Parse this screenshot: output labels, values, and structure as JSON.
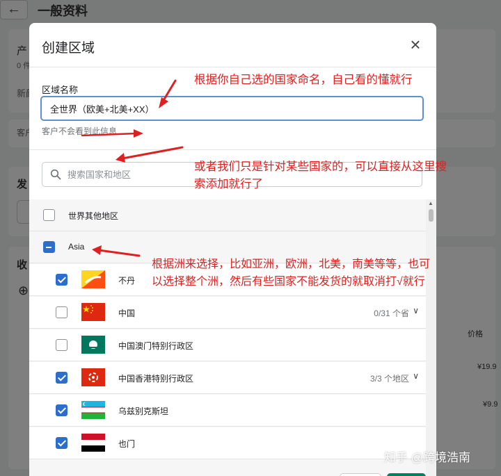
{
  "background": {
    "page_title": "一般资料",
    "back_icon": "arrow-left-icon",
    "peek_texts": [
      "产",
      "0 件",
      "新颜",
      "客户",
      "发",
      "收"
    ],
    "prices": [
      "价格",
      "¥19.9",
      "¥9.9"
    ]
  },
  "modal": {
    "title": "创建区域",
    "close_icon": "close-icon",
    "name_field": {
      "label": "区域名称",
      "value": "全世界（欧美+北美+XX）",
      "help": "客户不会看到此信息"
    },
    "search": {
      "placeholder": "搜索国家和地区",
      "value": ""
    },
    "rows": [
      {
        "type": "region",
        "label": "世界其他地区",
        "state": "unchecked"
      },
      {
        "type": "continent",
        "label": "Asia",
        "state": "indeterminate"
      },
      {
        "type": "country",
        "label": "不丹",
        "state": "checked",
        "flag": "bhutan"
      },
      {
        "type": "country",
        "label": "中国",
        "state": "unchecked",
        "flag": "china",
        "count": "0/31 个省"
      },
      {
        "type": "country",
        "label": "中国澳门特别行政区",
        "state": "unchecked",
        "flag": "macau"
      },
      {
        "type": "country",
        "label": "中国香港特别行政区",
        "state": "checked",
        "flag": "hongkong",
        "count": "3/3 个地区"
      },
      {
        "type": "country",
        "label": "乌兹别克斯坦",
        "state": "checked",
        "flag": "uzbekistan"
      },
      {
        "type": "country",
        "label": "也门",
        "state": "checked",
        "flag": "yemen"
      }
    ]
  },
  "annotations": {
    "note1": "根据你自己选的国家命名，自己看的懂就行",
    "note2_line1": "或者我们只是针对某些国家的，可以直接从这里搜",
    "note2_line2": "索添加就行了",
    "note3_line1": "根据洲来选择，比如亚洲，欧洲，北美，南美等等，也可",
    "note3_line2": "以选择整个洲，然后有些国家不能发货的就取消打√就行",
    "color": "#e02020"
  },
  "watermark": "知乎 @跨境浩南",
  "colors": {
    "primary_blue": "#2c6ecb",
    "focus_border": "#5c8fd6",
    "overlay": "rgba(0,0,0,0.5)"
  }
}
